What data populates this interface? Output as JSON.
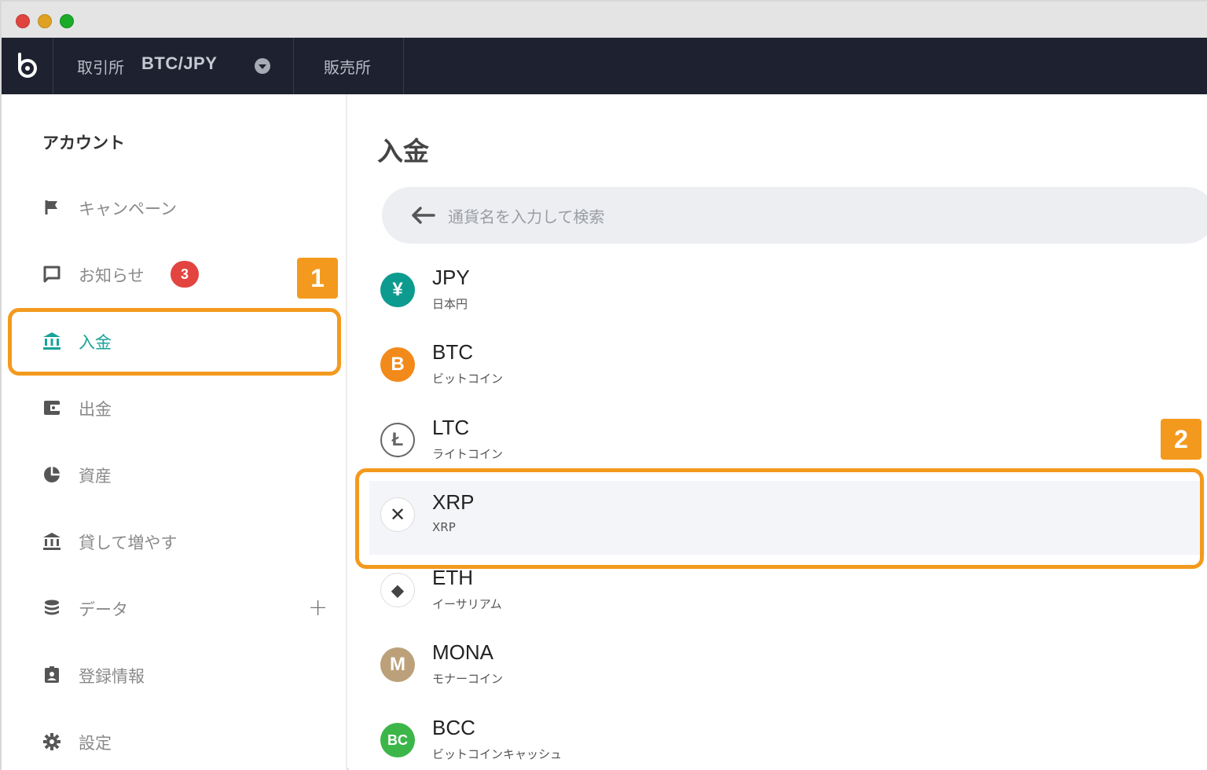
{
  "topnav": {
    "exchange_label": "取引所",
    "exchange_pair": "BTC/JPY",
    "store_label": "販売所"
  },
  "sidebar": {
    "title": "アカウント",
    "items": [
      {
        "label": "キャンペーン",
        "icon": "flag-icon"
      },
      {
        "label": "お知らせ",
        "icon": "message-icon",
        "badge": "3"
      },
      {
        "label": "入金",
        "icon": "bank-icon",
        "active": true
      },
      {
        "label": "出金",
        "icon": "wallet-icon"
      },
      {
        "label": "資産",
        "icon": "pie-chart-icon"
      },
      {
        "label": "貸して増やす",
        "icon": "bank-icon"
      },
      {
        "label": "データ",
        "icon": "database-icon",
        "expand": "+"
      },
      {
        "label": "登録情報",
        "icon": "id-badge-icon"
      },
      {
        "label": "設定",
        "icon": "gear-icon"
      }
    ]
  },
  "main": {
    "title": "入金",
    "search_placeholder": "通貨名を入力して検索",
    "coins": [
      {
        "symbol": "JPY",
        "name": "日本円",
        "icon_text": "¥",
        "color": "#0d9b8f"
      },
      {
        "symbol": "BTC",
        "name": "ビットコイン",
        "icon_text": "B",
        "color": "#f28a1b"
      },
      {
        "symbol": "LTC",
        "name": "ライトコイン",
        "icon_text": "Ł",
        "color": "#ffffff"
      },
      {
        "symbol": "XRP",
        "name": "XRP",
        "icon_text": "✕",
        "color": "#ffffff"
      },
      {
        "symbol": "ETH",
        "name": "イーサリアム",
        "icon_text": "◆",
        "color": "#ffffff"
      },
      {
        "symbol": "MONA",
        "name": "モナーコイン",
        "icon_text": "M",
        "color": "#bba07a"
      },
      {
        "symbol": "BCC",
        "name": "ビットコインキャッシュ",
        "icon_text": "BC",
        "color": "#3cb648"
      }
    ]
  },
  "annotations": {
    "step1": "1",
    "step2": "2"
  }
}
